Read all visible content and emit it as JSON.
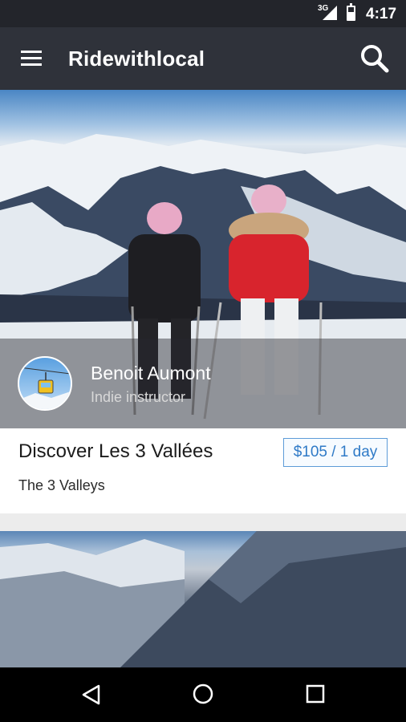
{
  "status_bar": {
    "network": "3G",
    "time": "4:17"
  },
  "app_bar": {
    "title": "Ridewithlocal",
    "menu_icon": "menu-icon",
    "search_icon": "search-icon"
  },
  "listing": {
    "instructor": {
      "name": "Benoit Aumont",
      "role": "Indie instructor"
    },
    "title": "Discover Les 3 Vallées",
    "price": "$105 / 1 day",
    "location": "The 3 Valleys"
  },
  "nav_bar": {
    "back_icon": "back-icon",
    "home_icon": "home-icon",
    "recents_icon": "recents-icon"
  },
  "colors": {
    "app_bar": "#2f323a",
    "status_bar": "#23252b",
    "accent": "#2f7ac7"
  }
}
